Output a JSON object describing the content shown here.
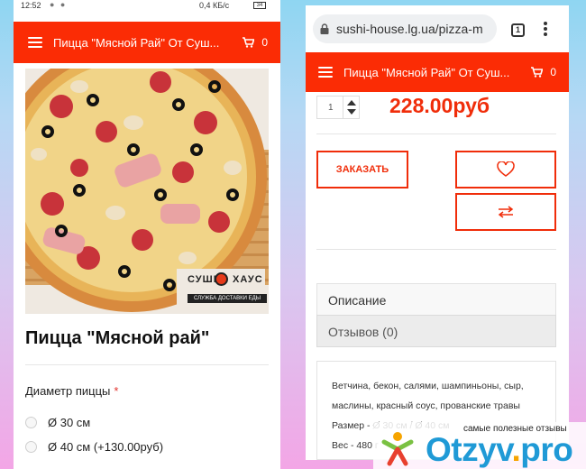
{
  "left_screen": {
    "status": {
      "time": "12:52",
      "speed": "0,4 КБ/с",
      "battery": "34"
    },
    "navbar": {
      "title": "Пицца \"Мясной Рай\" От Суш...",
      "cart_count": "0"
    },
    "brand": {
      "part1": "СУШИ",
      "part2": "ХАУС",
      "tagline": "СЛУЖБА ДОСТАВКИ ЕДЫ"
    },
    "product_title": "Пицца \"Мясной рай\"",
    "option_label": "Диаметр пиццы",
    "option_required": "*",
    "options": [
      {
        "label": "Ø 30 см"
      },
      {
        "label": "Ø 40 см (+130.00руб)"
      }
    ]
  },
  "right_screen": {
    "url": "sushi-house.lg.ua/pizza-m",
    "tab_count": "1",
    "navbar": {
      "title": "Пицца \"Мясной Рай\" От Суш...",
      "cart_count": "0"
    },
    "quantity": "1",
    "price": "228.00руб",
    "order_label": "ЗАКАЗАТЬ",
    "tabs": [
      {
        "label": "Описание"
      },
      {
        "label": "Отзывов (0)"
      }
    ],
    "description_lines": [
      "Ветчина, бекон, салями, шампиньоны, сыр,",
      "маслины, красный соус, прованские травы",
      "Размер - Ø 30 см / Ø 40 см",
      "Вес - 480 г"
    ]
  },
  "watermark": {
    "tagline": "самые полезные отзывы",
    "brand_main": "Otzyv",
    "brand_dot": ".",
    "brand_tld": "pro"
  },
  "colors": {
    "accent": "#fb2c05",
    "price": "#f02d0a",
    "watermark_blue": "#1f9ad6"
  },
  "icons": [
    "menu-icon",
    "cart-icon",
    "lock-icon",
    "tabs-icon",
    "more-vert-icon",
    "heart-icon",
    "compare-icon"
  ]
}
